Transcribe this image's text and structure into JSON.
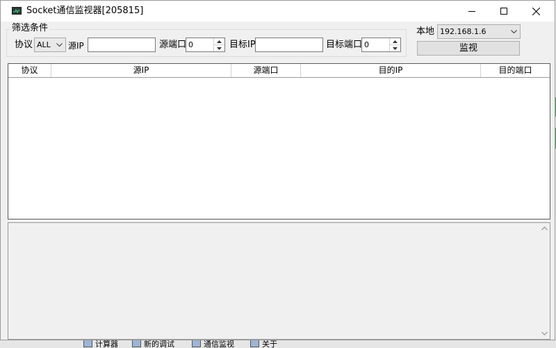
{
  "window": {
    "title": "Socket通信监视器[205815]"
  },
  "filter": {
    "group_title": "筛选条件",
    "protocol_label": "协议",
    "protocol_value": "ALL",
    "src_ip_label": "源IP",
    "src_ip_value": "",
    "src_port_label": "源端口",
    "src_port_value": "0",
    "dst_ip_label": "目标IP",
    "dst_ip_value": "",
    "dst_port_label": "目标端口",
    "dst_port_value": "0"
  },
  "local": {
    "label": "本地",
    "value": "192.168.1.6",
    "monitor_button": "监视"
  },
  "table": {
    "columns": [
      "协议",
      "源IP",
      "源端口",
      "目的IP",
      "目的端口"
    ],
    "rows": []
  },
  "taskbar": {
    "items": [
      "计算器",
      "新的调试",
      "通信监视",
      "关于"
    ]
  },
  "colors": {
    "background_green": "#3aa843",
    "window_bg": "#f0f0f0"
  }
}
